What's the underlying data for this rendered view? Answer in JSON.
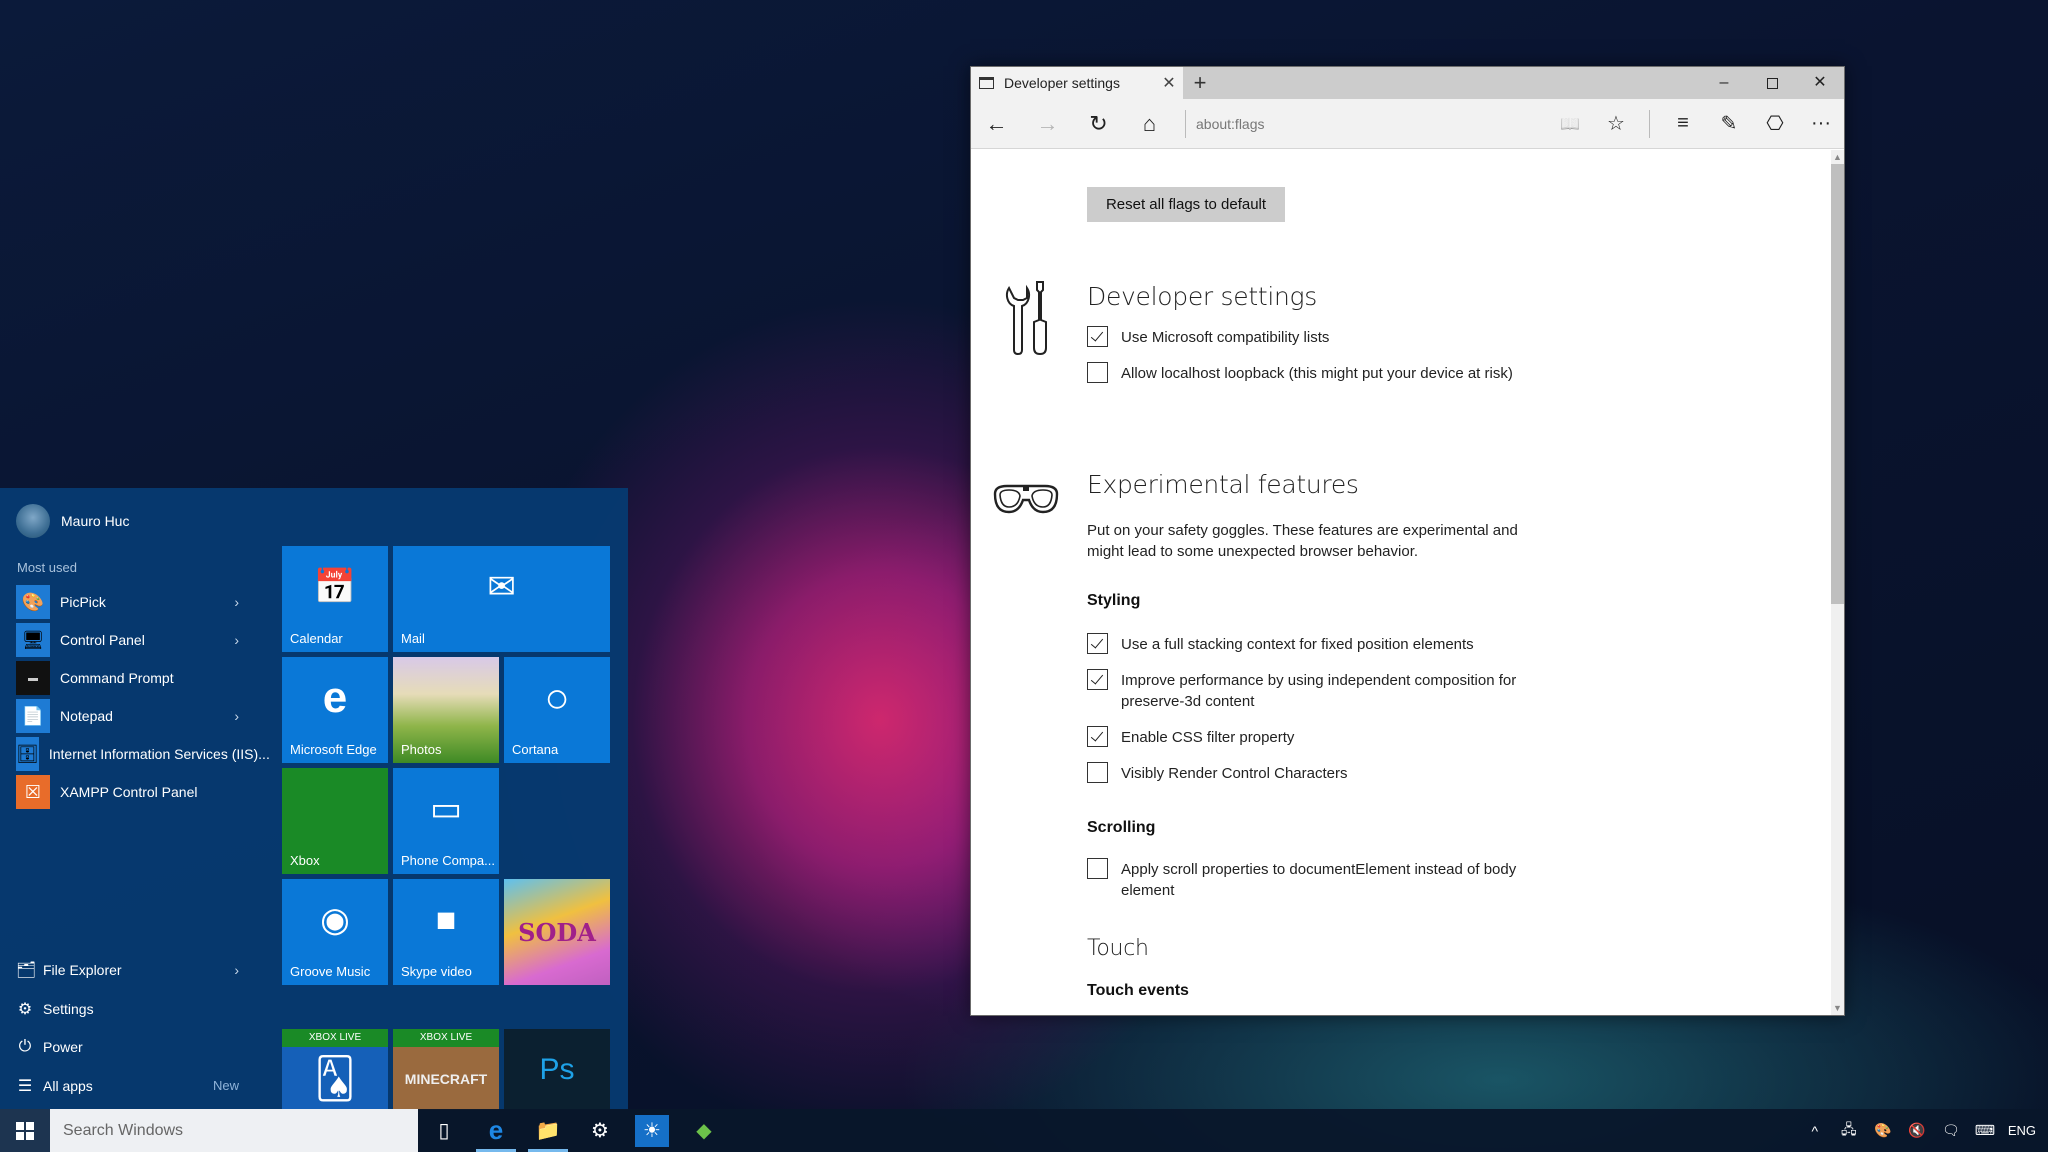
{
  "browser": {
    "tab": {
      "icon": "tab-page-icon",
      "title": "Developer settings",
      "close": "✕"
    },
    "new_tab": "+",
    "window_controls": {
      "minimize": "–",
      "maximize": "□",
      "close": "✕"
    },
    "nav": {
      "back": "←",
      "forward": "→",
      "refresh": "↻",
      "home": "⌂"
    },
    "url": "about:flags",
    "toolbar": {
      "reading_view": "📖",
      "favorite": "☆",
      "hub": "≡",
      "web_note": "✎",
      "share": "⎔",
      "more": "···"
    },
    "page": {
      "reset_button": "Reset all flags to default",
      "developer_settings": {
        "heading": "Developer settings",
        "flags": [
          {
            "label": "Use Microsoft compatibility lists",
            "checked": true
          },
          {
            "label": "Allow localhost loopback (this might put your device at risk)",
            "checked": false
          }
        ]
      },
      "experimental": {
        "heading": "Experimental features",
        "description": "Put on your safety goggles. These features are experimental and might lead to some unexpected browser behavior.",
        "styling": {
          "heading": "Styling",
          "flags": [
            {
              "label": "Use a full stacking context for fixed position elements",
              "checked": true
            },
            {
              "label": "Improve performance by using independent composition for preserve-3d content",
              "checked": true
            },
            {
              "label": "Enable CSS filter property",
              "checked": true
            },
            {
              "label": "Visibly Render Control Characters",
              "checked": false
            }
          ]
        },
        "scrolling": {
          "heading": "Scrolling",
          "flags": [
            {
              "label": "Apply scroll properties to documentElement instead of body element",
              "checked": false
            }
          ]
        }
      },
      "touch": {
        "heading": "Touch",
        "subheading": "Touch events"
      }
    }
  },
  "start_menu": {
    "user_name": "Mauro Huc",
    "most_used_label": "Most used",
    "apps": [
      {
        "label": "PicPick",
        "icon": "picpick-icon",
        "glyph": "🎨",
        "has_submenu": true
      },
      {
        "label": "Control Panel",
        "icon": "control-panel-icon",
        "glyph": "🖥",
        "has_submenu": true
      },
      {
        "label": "Command Prompt",
        "icon": "command-prompt-icon",
        "glyph": "▬",
        "has_submenu": false
      },
      {
        "label": "Notepad",
        "icon": "notepad-icon",
        "glyph": "📄",
        "has_submenu": true
      },
      {
        "label": "Internet Information Services (IIS)...",
        "icon": "iis-icon",
        "glyph": "🗄",
        "has_submenu": false
      },
      {
        "label": "XAMPP Control Panel",
        "icon": "xampp-icon",
        "glyph": "☒",
        "has_submenu": false
      }
    ],
    "bottom": [
      {
        "label": "File Explorer",
        "glyph": "🗂",
        "has_submenu": true
      },
      {
        "label": "Settings",
        "glyph": "⚙"
      },
      {
        "label": "Power",
        "glyph": "⏻"
      },
      {
        "label": "All apps",
        "glyph": "☰",
        "badge": "New"
      }
    ],
    "chevron": "›",
    "tiles": [
      {
        "label": "Calendar",
        "glyph": "📅"
      },
      {
        "label": "Mail",
        "glyph": "✉"
      },
      {
        "label": "Microsoft Edge",
        "glyph": "e"
      },
      {
        "label": "Photos",
        "glyph": ""
      },
      {
        "label": "Cortana",
        "glyph": "○"
      },
      {
        "label": "Xbox",
        "glyph": ""
      },
      {
        "label": "Phone Compa...",
        "glyph": "▭"
      },
      {
        "label": "Groove Music",
        "glyph": "◉"
      },
      {
        "label": "Skype video",
        "glyph": "■"
      },
      {
        "label": "SODA",
        "glyph": ""
      },
      {
        "label": "XBOX LIVE",
        "glyph": "🂡"
      },
      {
        "label": "XBOX LIVE",
        "glyph": "MINECRAFT"
      },
      {
        "label": "",
        "glyph": "Ps"
      }
    ]
  },
  "taskbar": {
    "search_placeholder": "Search Windows",
    "pinned": [
      {
        "name": "task-view",
        "glyph": "▯"
      },
      {
        "name": "edge",
        "glyph": "e",
        "active": true
      },
      {
        "name": "file-explorer",
        "glyph": "📁",
        "active": true
      },
      {
        "name": "settings",
        "glyph": "⚙"
      },
      {
        "name": "weather-app",
        "glyph": "☀"
      },
      {
        "name": "green-app",
        "glyph": "◆"
      }
    ],
    "tray": {
      "show_hidden": "^",
      "network": "🖧",
      "picpick": "🎨",
      "volume": "🔇",
      "action_center": "🗨",
      "keyboard": "⌨",
      "language": "ENG"
    }
  }
}
